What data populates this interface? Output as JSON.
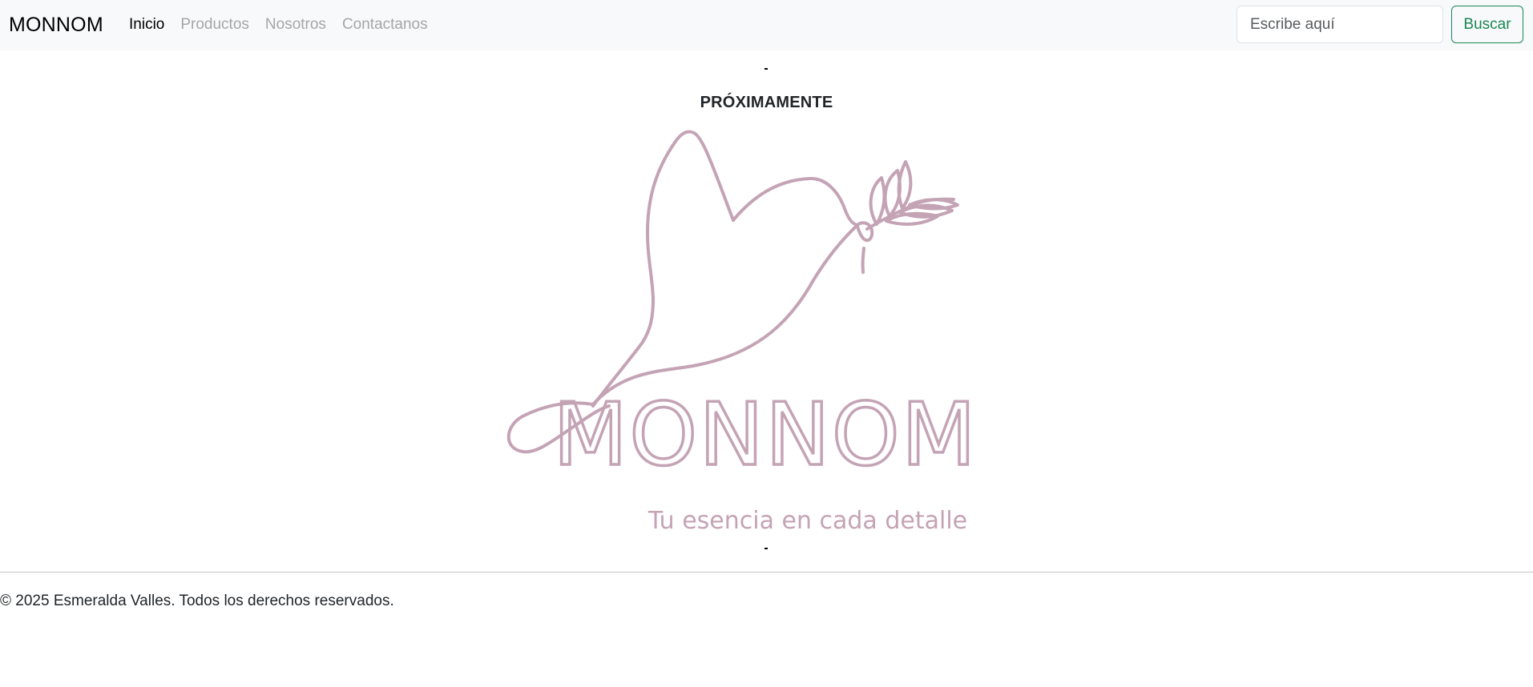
{
  "navbar": {
    "brand": "MONNOM",
    "links": [
      {
        "label": "Inicio",
        "active": true
      },
      {
        "label": "Productos",
        "active": false
      },
      {
        "label": "Nosotros",
        "active": false
      },
      {
        "label": "Contactanos",
        "active": false
      }
    ],
    "search": {
      "placeholder": "Escribe aquí",
      "value": ""
    },
    "search_button_label": "Buscar"
  },
  "main": {
    "heading": "PRÓXIMAMENTE",
    "logo": {
      "wordmark": "MONNOM",
      "tagline": "Tu esencia en cada detalle",
      "icon": "dove-with-olive-branch-icon",
      "color": "#c4a3b5"
    }
  },
  "footer": {
    "copyright": "© 2025 Esmeralda Valles. Todos los derechos reservados."
  },
  "colors": {
    "navbar_bg": "#f8f9fa",
    "nav_link_muted": "#a4a6a8",
    "nav_link_active": "#000000",
    "button_accent": "#198754",
    "logo": "#c4a3b5"
  }
}
